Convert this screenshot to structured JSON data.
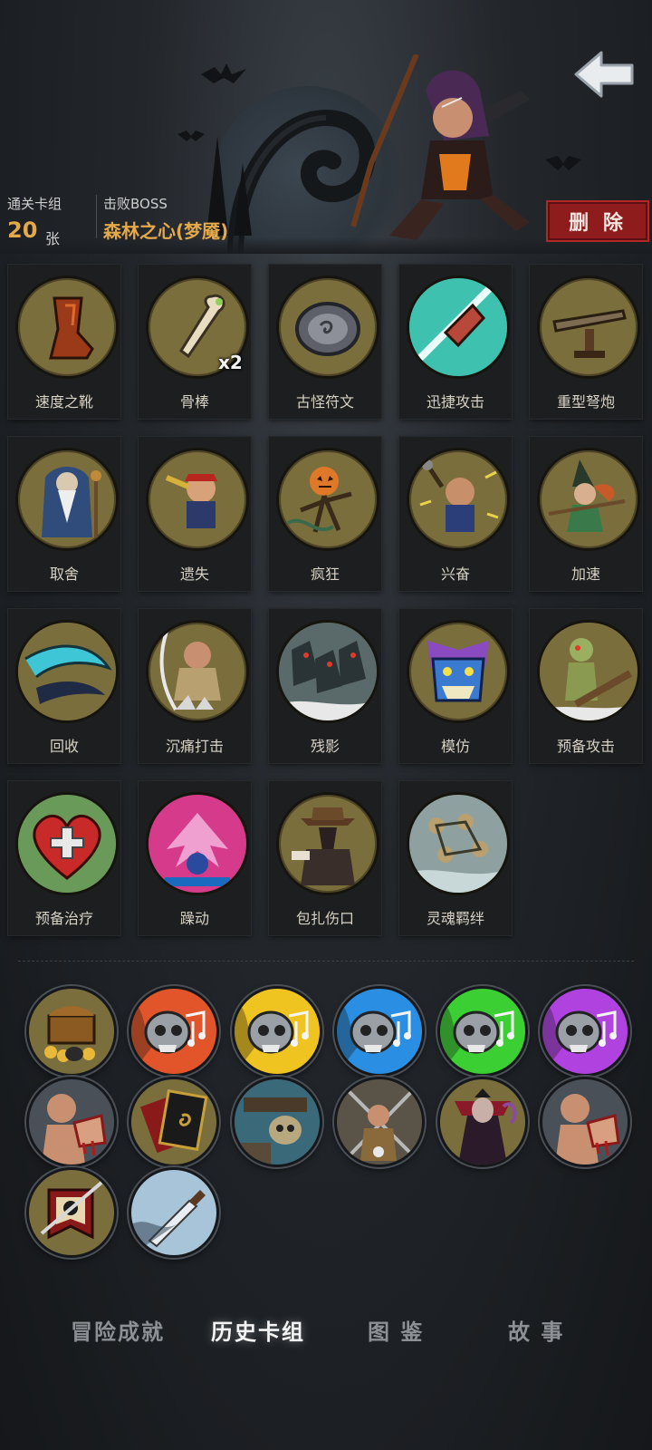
{
  "header": {
    "cleared_deck_label": "通关卡组",
    "card_count": "20",
    "card_unit": "张",
    "defeated_boss_label": "击败BOSS",
    "boss_name": "森林之心(梦魇)",
    "delete_label": "删 除"
  },
  "cards": [
    {
      "name": "速度之靴",
      "icon": "boot-icon"
    },
    {
      "name": "骨棒",
      "icon": "bone-club-icon",
      "badge": "x2"
    },
    {
      "name": "古怪符文",
      "icon": "rune-stone-icon"
    },
    {
      "name": "迅捷攻击",
      "icon": "swift-strike-icon"
    },
    {
      "name": "重型弩炮",
      "icon": "ballista-icon"
    },
    {
      "name": "取舍",
      "icon": "sage-icon"
    },
    {
      "name": "遗失",
      "icon": "pirate-icon"
    },
    {
      "name": "疯狂",
      "icon": "pumpkin-icon"
    },
    {
      "name": "兴奋",
      "icon": "excited-dwarf-icon"
    },
    {
      "name": "加速",
      "icon": "witch-icon"
    },
    {
      "name": "回收",
      "icon": "whirl-icon"
    },
    {
      "name": "沉痛打击",
      "icon": "brute-strike-icon"
    },
    {
      "name": "残影",
      "icon": "shadow-clones-icon"
    },
    {
      "name": "模仿",
      "icon": "troll-mask-icon"
    },
    {
      "name": "预备攻击",
      "icon": "goblin-icon"
    },
    {
      "name": "预备治疗",
      "icon": "heart-cross-icon"
    },
    {
      "name": "躁动",
      "icon": "frenzy-icon"
    },
    {
      "name": "包扎伤口",
      "icon": "plague-doctor-icon"
    },
    {
      "name": "灵魂羁绊",
      "icon": "soul-bond-icon"
    }
  ],
  "relics": [
    {
      "icon": "treasure-chest-icon"
    },
    {
      "icon": "skull-red-flame-icon",
      "color": "#e2552a"
    },
    {
      "icon": "skull-yellow-flame-icon",
      "color": "#f0c420"
    },
    {
      "icon": "skull-blue-flame-icon",
      "color": "#2a8fe2"
    },
    {
      "icon": "skull-green-flame-icon",
      "color": "#3ccf34"
    },
    {
      "icon": "skull-purple-flame-icon",
      "color": "#b043e0"
    },
    {
      "icon": "bloody-fist-icon"
    },
    {
      "icon": "spiral-card-icon"
    },
    {
      "icon": "skull-pirate-icon"
    },
    {
      "icon": "warrior-icon"
    },
    {
      "icon": "vampire-icon"
    },
    {
      "icon": "bloody-fist-icon"
    },
    {
      "icon": "banner-skull-icon"
    },
    {
      "icon": "dagger-icon"
    }
  ],
  "tabs": [
    {
      "label": "冒险成就",
      "active": false
    },
    {
      "label": "历史卡组",
      "active": true
    },
    {
      "label": "图  鉴",
      "active": false
    },
    {
      "label": "故  事",
      "active": false
    }
  ]
}
